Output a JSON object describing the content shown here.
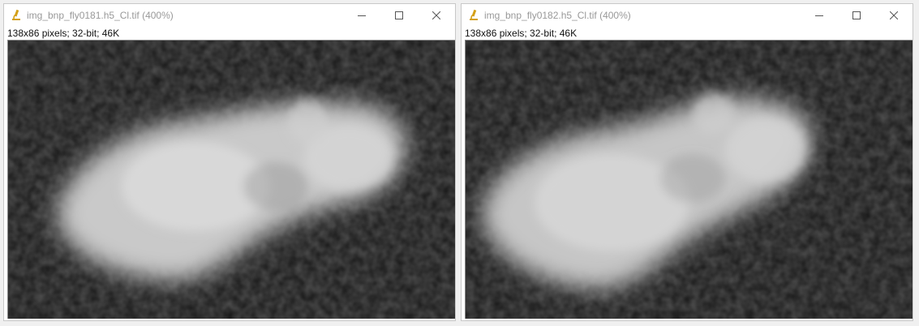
{
  "windows": [
    {
      "title": "img_bnp_fly0181.h5_Cl.tif (400%)",
      "info": "138x86 pixels; 32-bit; 46K"
    },
    {
      "title": "img_bnp_fly0182.h5_Cl.tif (400%)",
      "info": "138x86 pixels; 32-bit; 46K"
    }
  ],
  "icons": {
    "app": "microscope-icon",
    "minimize": "minimize-icon",
    "maximize": "maximize-icon",
    "close": "close-icon"
  },
  "colors": {
    "title_text": "#999999",
    "info_text": "#111111",
    "icon_accent": "#d4a017"
  }
}
